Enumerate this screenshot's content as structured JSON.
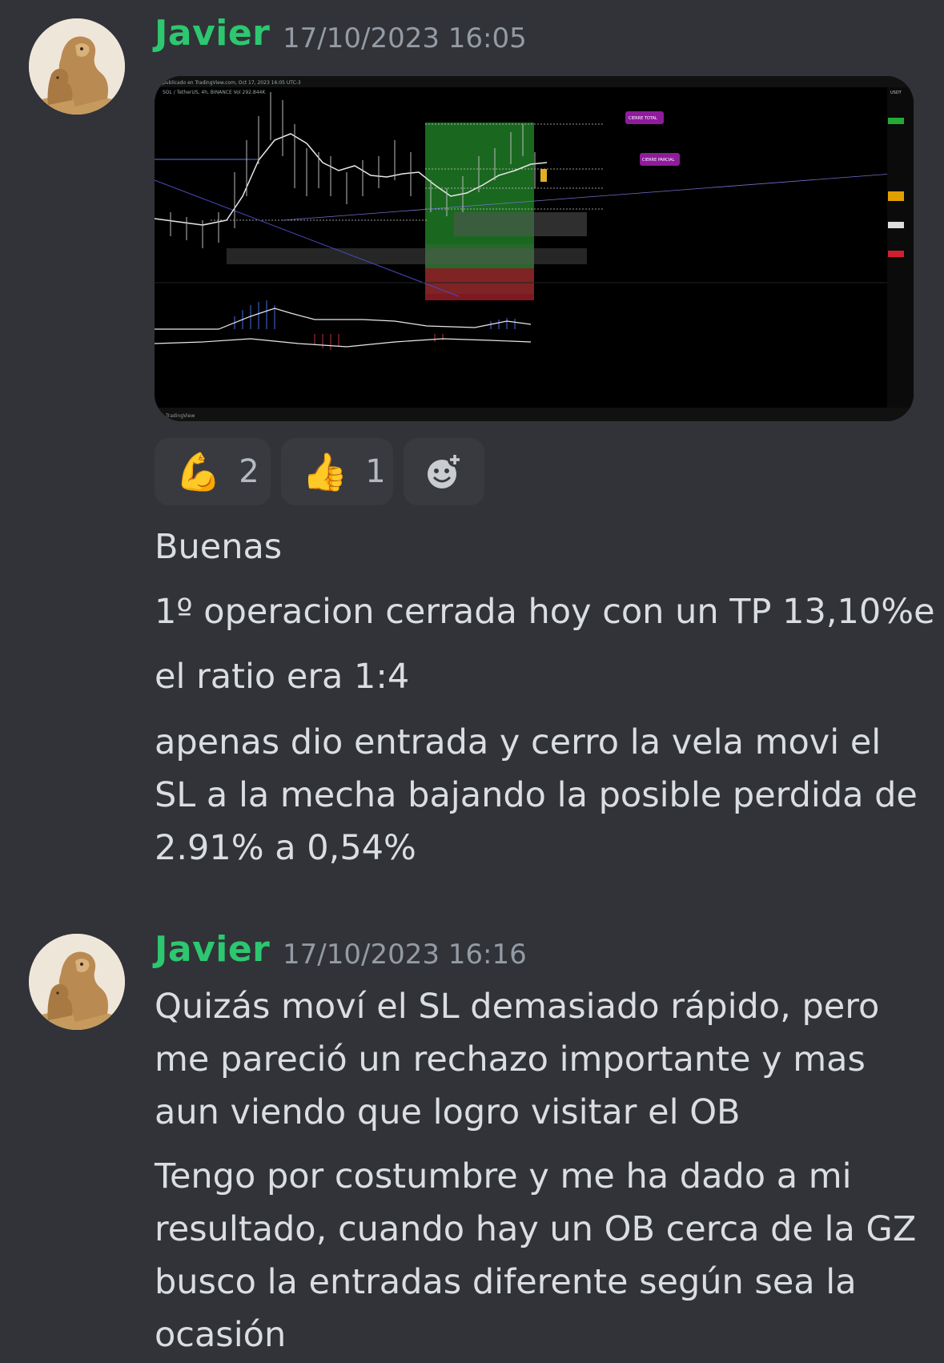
{
  "messages": [
    {
      "author": "Javier",
      "timestamp": "17/10/2023 16:05",
      "attachment": {
        "type": "trading-chart-screenshot",
        "header_text": "publicado en TradingView.com, Oct 17, 2023 16:05 UTC-3",
        "symbol_line": "SOL / TetherUS, 4h, BINANCE Vol 292.844K",
        "labels": [
          "CIERRE TOTAL",
          "CIERRE PARCIAL"
        ],
        "footer_text": "TradingView",
        "price_axis_label": "USDT",
        "accent_green": "#1f7a24",
        "accent_red": "#8b1c25",
        "label_purple": "#8e1c9c"
      },
      "reactions": [
        {
          "emoji": "💪",
          "count": "2"
        },
        {
          "emoji": "👍",
          "count": "1"
        }
      ],
      "add_reaction_icon": "add-reaction-icon",
      "lines": [
        "Buenas",
        "1º operacion cerrada hoy con un TP 13,10%e",
        "el ratio era 1:4",
        "apenas dio entrada y cerro la vela movi el",
        "SL a la mecha bajando la posible perdida de",
        "2.91% a 0,54%"
      ]
    },
    {
      "author": "Javier",
      "timestamp": "17/10/2023 16:16",
      "lines": [
        "Quizás moví el SL demasiado rápido, pero",
        "me pareció un rechazo importante y mas",
        "aun viendo que logro visitar el OB",
        "Tengo por costumbre y me ha dado a mi",
        "resultado, cuando hay un OB cerca de la GZ",
        "busco la entradas diferente según sea la",
        "ocasión"
      ]
    }
  ],
  "colors": {
    "background": "#313338",
    "author": "#2dc770",
    "timestamp": "#949ba4",
    "text": "#dbdee1",
    "reaction_bg": "#383a40"
  }
}
